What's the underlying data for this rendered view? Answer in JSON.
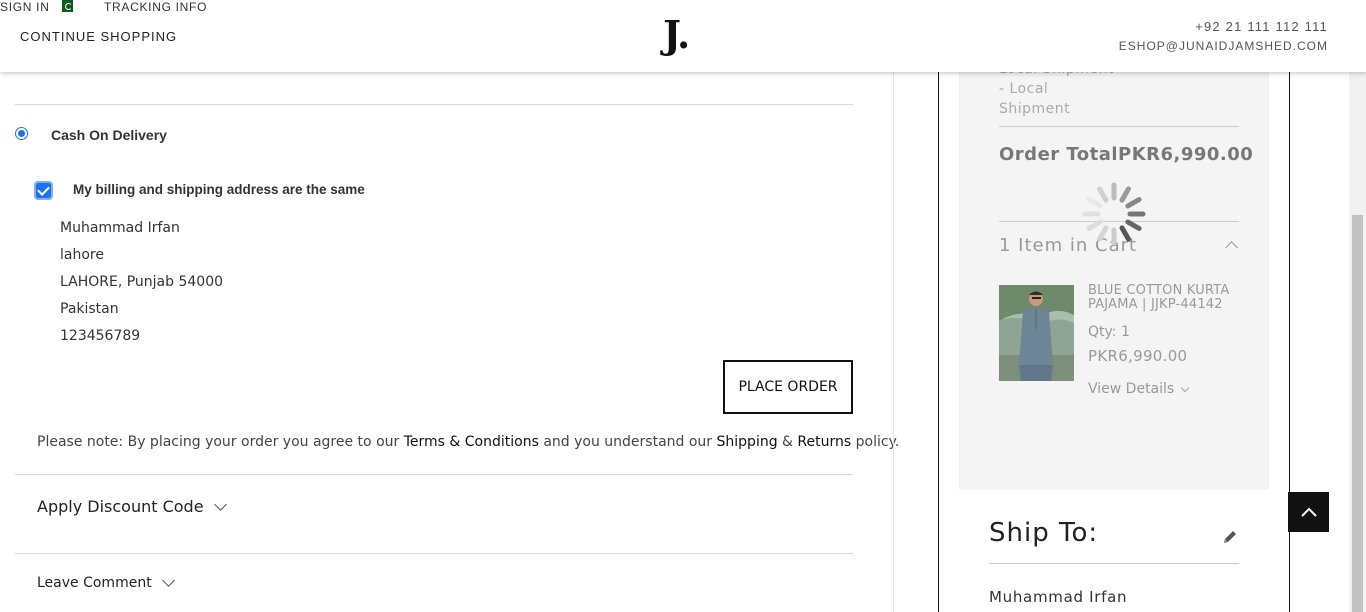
{
  "header": {
    "sign_in": "SIGN IN",
    "tracking": "TRACKING INFO",
    "continue": "CONTINUE SHOPPING",
    "logo": "J.",
    "phone": "+92 21 111 112 111",
    "email": "ESHOP@JUNAIDJAMSHED.COM"
  },
  "payment": {
    "method_label": "Cash On Delivery",
    "same_address_label": "My billing and shipping address are the same",
    "address_lines": [
      "Muhammad Irfan",
      "lahore",
      "LAHORE, Punjab 54000",
      "Pakistan",
      "123456789"
    ],
    "place_order": "PLACE ORDER",
    "note_prefix": "Please note: By placing your order you agree to our ",
    "note_terms": "Terms & Conditions",
    "note_middle": " and you understand our ",
    "note_shipping": "Shipping",
    "note_amp": " & ",
    "note_returns": "Returns",
    "note_suffix": " policy."
  },
  "discount": {
    "label": "Apply Discount Code"
  },
  "comment": {
    "label": "Leave Comment"
  },
  "summary": {
    "shipment_line1": "Local Shipment",
    "shipment_line2": "- Local",
    "shipment_line3": "Shipment",
    "order_total_label": "Order Total",
    "order_total_value": "PKR6,990.00",
    "items_in_cart": "1 Item in Cart",
    "product": {
      "name": "BLUE COTTON KURTA PAJAMA | JJKP-44142",
      "qty": "Qty: 1",
      "price": "PKR6,990.00",
      "view_details": "View Details"
    }
  },
  "ship_to": {
    "title": "Ship To:",
    "name": "Muhammad Irfan"
  },
  "colors": {
    "accent": "#1a73e8",
    "flag_green": "#0b5d1e"
  },
  "icons": [
    "flag-icon",
    "chevron-down-icon",
    "chevron-up-icon",
    "pencil-icon",
    "arrow-up-icon",
    "spinner-icon"
  ]
}
